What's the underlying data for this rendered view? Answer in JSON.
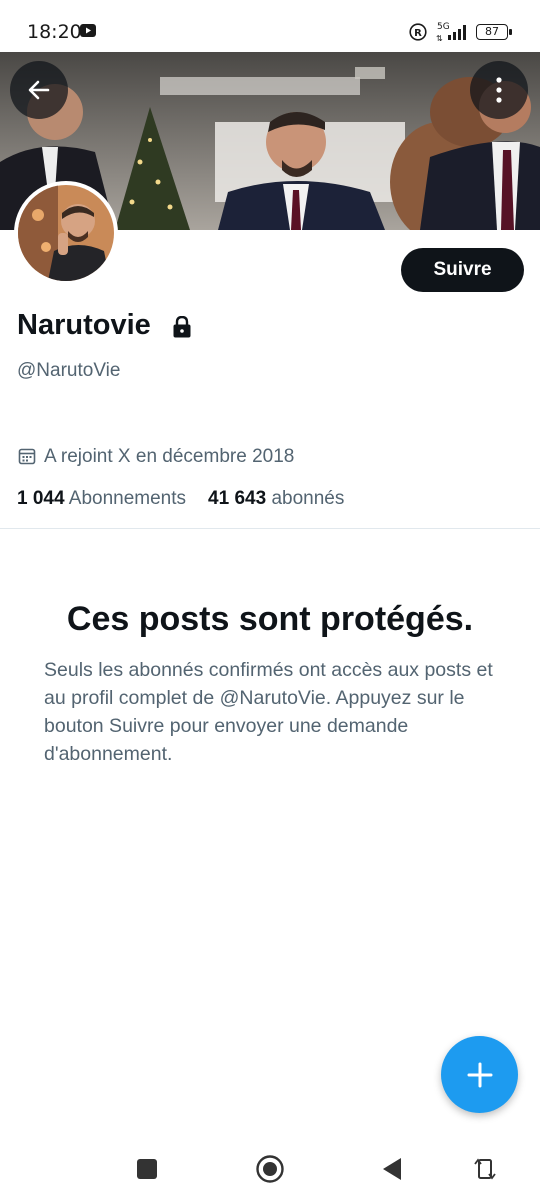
{
  "status_bar": {
    "time": "18:20",
    "network": "5G",
    "battery": "87",
    "icons": [
      "youtube-icon",
      "registered-icon",
      "signal-icon",
      "battery-icon"
    ]
  },
  "profile": {
    "display_name": "Narutovie",
    "handle": "@NarutoVie",
    "joined": "A rejoint X en décembre 2018",
    "following_count": "1 044",
    "following_label": "Abonnements",
    "followers_count": "41 643",
    "followers_label": "abonnés",
    "protected": true
  },
  "actions": {
    "follow_label": "Suivre",
    "back_icon": "arrow-left-icon",
    "more_icon": "more-vertical-icon",
    "compose_icon": "plus-icon"
  },
  "protected_notice": {
    "title": "Ces posts sont protégés.",
    "body": "Seuls les abonnés confirmés ont accès aux posts et au profil complet de @NarutoVie. Appuyez sur le bouton Suivre pour envoyer une demande d'abonnement."
  },
  "nav_bar": {
    "icons": [
      "recents-square-icon",
      "home-circle-icon",
      "back-triangle-icon",
      "rotate-icon"
    ]
  },
  "colors": {
    "accent": "#1d9bf0",
    "primary_text": "#0f1419",
    "secondary_text": "#536471",
    "follow_button": "#0f1419",
    "divider": "#e1e8ed"
  }
}
